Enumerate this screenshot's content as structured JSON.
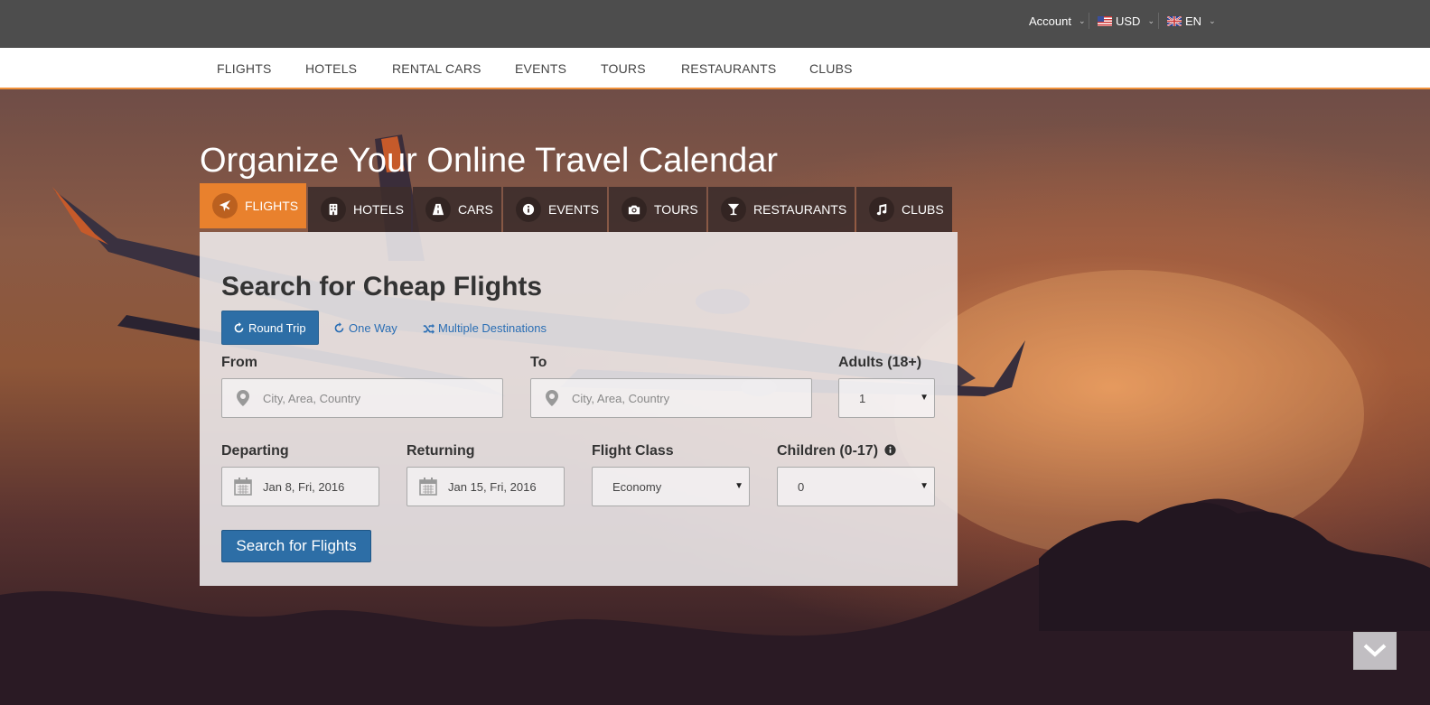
{
  "topbar": {
    "account_label": "Account",
    "currency_label": "USD",
    "language_label": "EN"
  },
  "mainnav": {
    "items": [
      {
        "label": "FLIGHTS"
      },
      {
        "label": "HOTELS"
      },
      {
        "label": "RENTAL CARS"
      },
      {
        "label": "EVENTS"
      },
      {
        "label": "TOURS"
      },
      {
        "label": "RESTAURANTS"
      },
      {
        "label": "CLUBS"
      }
    ]
  },
  "hero": {
    "title": "Organize Your Online Travel Calendar"
  },
  "tabs": [
    {
      "label": "FLIGHTS",
      "icon": "plane-icon",
      "active": true
    },
    {
      "label": "HOTELS",
      "icon": "building-icon",
      "active": false
    },
    {
      "label": "CARS",
      "icon": "road-icon",
      "active": false
    },
    {
      "label": "EVENTS",
      "icon": "info-icon",
      "active": false
    },
    {
      "label": "TOURS",
      "icon": "camera-icon",
      "active": false
    },
    {
      "label": "RESTAURANTS",
      "icon": "glass-icon",
      "active": false
    },
    {
      "label": "CLUBS",
      "icon": "music-icon",
      "active": false
    }
  ],
  "search": {
    "title": "Search for Cheap Flights",
    "trip_types": {
      "round_trip": "Round Trip",
      "one_way": "One Way",
      "multiple": "Multiple Destinations"
    },
    "from_label": "From",
    "from_placeholder": "City, Area, Country",
    "to_label": "To",
    "to_placeholder": "City, Area, Country",
    "adults_label": "Adults (18+)",
    "adults_value": "1",
    "departing_label": "Departing",
    "departing_value": "Jan 8, Fri, 2016",
    "returning_label": "Returning",
    "returning_value": "Jan 15, Fri, 2016",
    "class_label": "Flight Class",
    "class_value": "Economy",
    "children_label": "Children (0-17)",
    "children_value": "0",
    "submit_label": "Search for Flights"
  },
  "colors": {
    "accent": "#e9812d",
    "primary": "#2d6ea6",
    "topbar": "#4d4d4d"
  }
}
